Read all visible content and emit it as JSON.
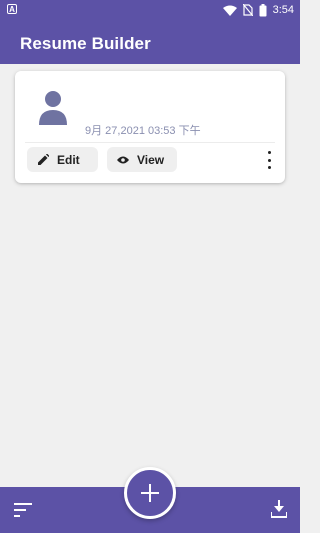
{
  "status_bar": {
    "left_icon": "A",
    "time": "3:54",
    "battery_level": "8"
  },
  "app_bar": {
    "title": "Resume Builder"
  },
  "resumes": [
    {
      "avatar_icon": "person-icon",
      "timestamp": "9月 27,2021 03:53 下午",
      "edit_label": "Edit",
      "view_label": "View"
    }
  ],
  "bottom_bar": {
    "sort_icon": "sort-icon",
    "add_icon": "plus-icon",
    "download_icon": "download-icon"
  },
  "colors": {
    "primary": "#5c52a6",
    "background": "#f0f0f0",
    "avatar": "#6f73a1"
  }
}
